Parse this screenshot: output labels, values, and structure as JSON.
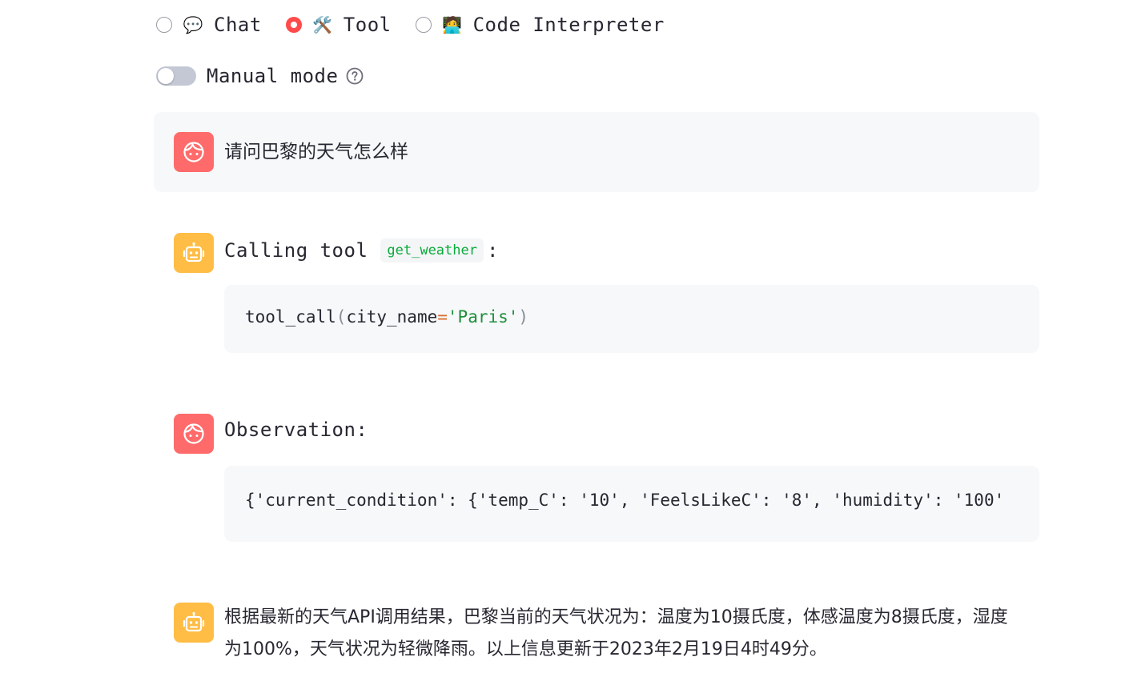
{
  "modes": [
    {
      "id": "chat",
      "emoji": "💬",
      "label": "Chat",
      "selected": false
    },
    {
      "id": "tool",
      "emoji": "🛠️",
      "label": "Tool",
      "selected": true
    },
    {
      "id": "code",
      "emoji": "🧑‍💻",
      "label": "Code Interpreter",
      "selected": false
    }
  ],
  "manual_mode": {
    "label": "Manual mode",
    "enabled": false
  },
  "colors": {
    "accent": "#ff4b4b",
    "user_avatar": "#ff6b6b",
    "bot_avatar": "#ffbd45",
    "code_green": "#09ab3b"
  },
  "messages": {
    "user_question": "请问巴黎的天气怎么样",
    "tool_call": {
      "prefix": "Calling tool",
      "tool_name": "get_weather",
      "suffix": ":",
      "code": {
        "fn": "tool_call",
        "open": "(",
        "arg": "city_name",
        "eq": "=",
        "val": "'Paris'",
        "close": ")"
      }
    },
    "observation": {
      "label": "Observation:",
      "content": "{'current_condition': {'temp_C': '10', 'FeelsLikeC': '8', 'humidity': '100'"
    },
    "final_answer": "根据最新的天气API调用结果，巴黎当前的天气状况为：温度为10摄氏度，体感温度为8摄氏度，湿度为100%，天气状况为轻微降雨。以上信息更新于2023年2月19日4时49分。"
  }
}
